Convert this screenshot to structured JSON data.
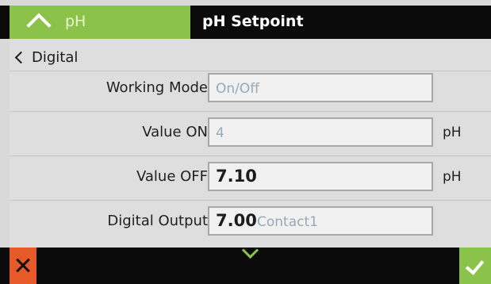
{
  "header": {
    "back_tab_label": "pH",
    "title": "pH Setpoint"
  },
  "nav": {
    "back_label": "Digital"
  },
  "rows": [
    {
      "label": "Working Mode",
      "value": "On/Off",
      "unit": ""
    },
    {
      "label": "Value ON",
      "value": "4",
      "unit": "pH"
    },
    {
      "label": "Value OFF",
      "value": "7.10",
      "unit": "pH"
    },
    {
      "label": "Digital Output",
      "value": "Contact1",
      "overlay": "7.00",
      "unit": ""
    }
  ],
  "colors": {
    "accent": "#8bc34a",
    "cancel": "#e65a2a",
    "header_bg": "#0b0b0b"
  },
  "icons": {
    "header_back": "chevron-up-icon",
    "nav_back": "chevron-left-icon",
    "more": "chevron-down-icon",
    "cancel": "close-icon",
    "confirm": "check-icon"
  }
}
